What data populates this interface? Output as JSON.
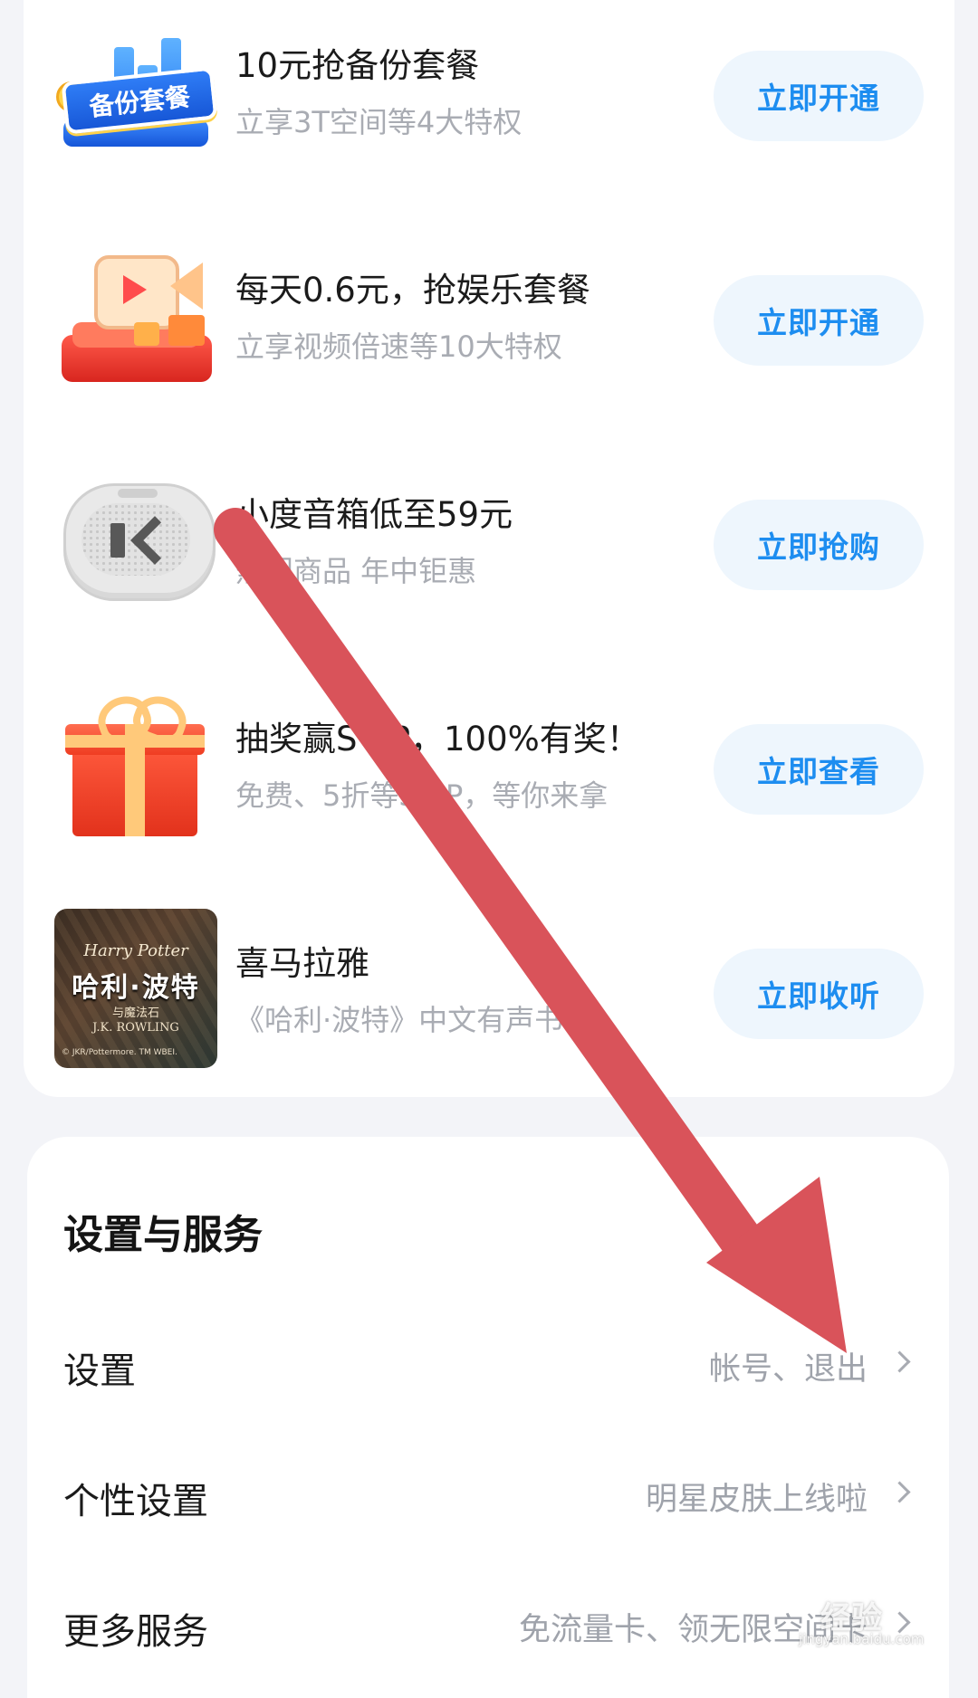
{
  "promotions": [
    {
      "title": "10元抢备份套餐",
      "subtitle": "立享3T空间等4大特权",
      "button": "立即开通",
      "thumb_label": "备份套餐"
    },
    {
      "title": "每天0.6元，抢娱乐套餐",
      "subtitle": "立享视频倍速等10大特权",
      "button": "立即开通"
    },
    {
      "title": "小度音箱低至59元",
      "subtitle": "热门商品 年中钜惠",
      "button": "立即抢购"
    },
    {
      "title": "抽奖赢SVIP，100%有奖！",
      "subtitle": "免费、5折等SVIP，等你来拿",
      "button": "立即查看"
    },
    {
      "title": "喜马拉雅",
      "subtitle": "《哈利·波特》中文有声书",
      "button": "立即收听",
      "thumb": {
        "en": "Harry Potter",
        "cn": "哈利·波特",
        "sub": "与魔法石",
        "author": "J.K. ROWLING",
        "copyright": "© JKR/Pottermore. TM WBEI."
      }
    }
  ],
  "settings_section": {
    "title": "设置与服务",
    "rows": [
      {
        "label": "设置",
        "hint": "帐号、退出"
      },
      {
        "label": "个性设置",
        "hint": "明星皮肤上线啦"
      },
      {
        "label": "更多服务",
        "hint": "免流量卡、领无限空间卡"
      }
    ]
  },
  "annotation": {
    "color": "#d9535a"
  },
  "watermark": {
    "text": "经验",
    "url": "jingyan.baidu.com"
  },
  "colors": {
    "accent": "#1d8df0",
    "button_bg": "#eef6fd",
    "page_bg": "#f3f4f8"
  }
}
